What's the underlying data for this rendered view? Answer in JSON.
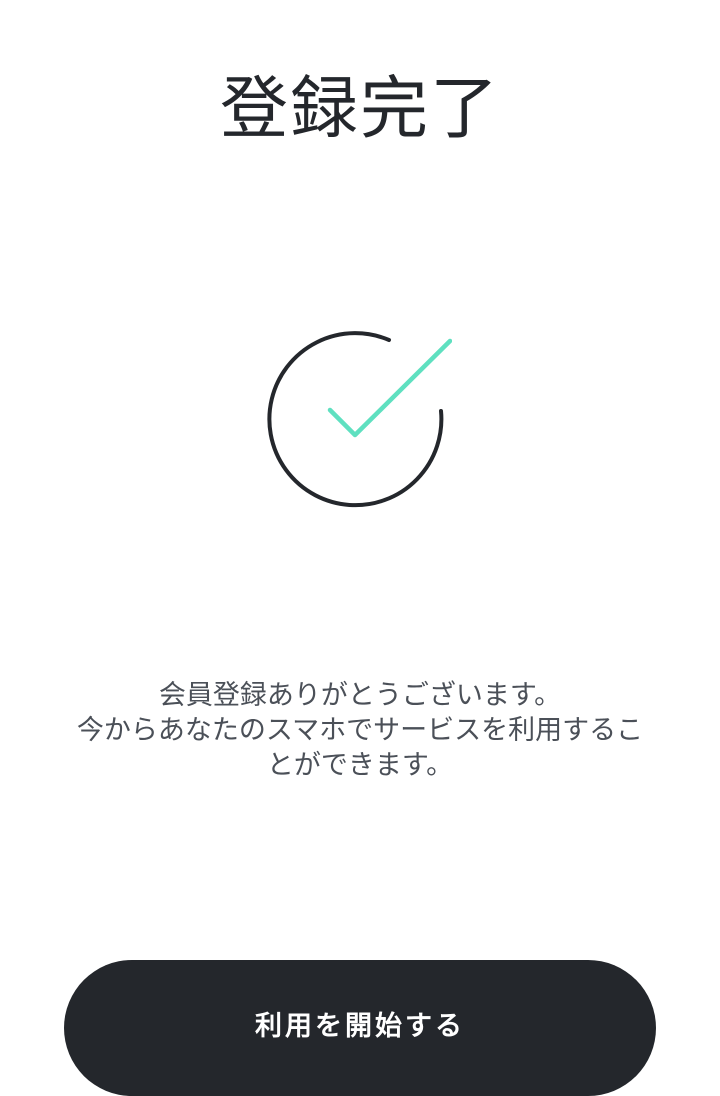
{
  "header": {
    "title": "登録完了"
  },
  "status_icon": {
    "name": "success-check-icon",
    "ring_color": "#24272c",
    "check_color": "#5fe0c0"
  },
  "message": {
    "lines": [
      "会員登録ありがとうございます。",
      "今からあなたのスマホでサービスを利用するこ",
      "とができます。"
    ]
  },
  "actions": {
    "start_label": "利用を開始する",
    "button_color": "#24272c"
  }
}
